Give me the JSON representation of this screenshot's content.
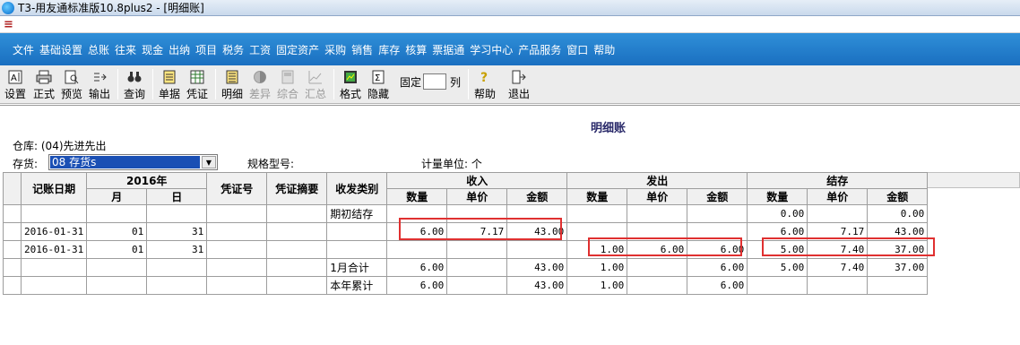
{
  "window": {
    "title": "T3-用友通标准版10.8plus2 - [明细账]"
  },
  "menu": [
    "文件",
    "基础设置",
    "总账",
    "往来",
    "现金",
    "出纳",
    "项目",
    "税务",
    "工资",
    "固定资产",
    "采购",
    "销售",
    "库存",
    "核算",
    "票据通",
    "学习中心",
    "产品服务",
    "窗口",
    "帮助"
  ],
  "toolbar": {
    "buttons": [
      {
        "label": "设置",
        "icon": "A|"
      },
      {
        "label": "正式",
        "icon": "print"
      },
      {
        "label": "预览",
        "icon": "preview"
      },
      {
        "label": "输出",
        "icon": "export"
      },
      {
        "label": "查询",
        "icon": "binoculars"
      },
      {
        "label": "单据",
        "icon": "doc"
      },
      {
        "label": "凭证",
        "icon": "voucher"
      },
      {
        "label": "明细",
        "icon": "detail"
      },
      {
        "label": "差异",
        "icon": "diff"
      },
      {
        "label": "综合",
        "icon": "combo"
      },
      {
        "label": "汇总",
        "icon": "sum"
      },
      {
        "label": "格式",
        "icon": "format"
      },
      {
        "label": "隐藏",
        "icon": "hide"
      },
      {
        "label": "帮助",
        "icon": "help"
      },
      {
        "label": "退出",
        "icon": "exit"
      }
    ],
    "fixed_label": "固定",
    "fixed_value": "",
    "col_label": "列"
  },
  "report": {
    "title": "明细账",
    "warehouse_label": "仓库:",
    "warehouse_value": "(04)先进先出",
    "stock_label": "存货:",
    "stock_value": "08 存货s",
    "spec_label": "规格型号:",
    "unit_label": "计量单位:",
    "unit_value": "个"
  },
  "table": {
    "headers": {
      "date": "记账日期",
      "year": "2016年",
      "month": "月",
      "day": "日",
      "voucher_no": "凭证号",
      "voucher_summary": "凭证摘要",
      "type": "收发类别",
      "in": "收入",
      "out": "发出",
      "balance": "结存",
      "qty": "数量",
      "price": "单价",
      "amount": "金额"
    },
    "rows": [
      {
        "date": "",
        "month": "",
        "day": "",
        "vno": "",
        "vsum": "",
        "type": "期初结存",
        "in_q": "",
        "in_p": "",
        "in_a": "",
        "out_q": "",
        "out_p": "",
        "out_a": "",
        "bal_q": "0.00",
        "bal_p": "",
        "bal_a": "0.00"
      },
      {
        "date": "2016-01-31",
        "month": "01",
        "day": "31",
        "vno": "",
        "vsum": "",
        "type": "",
        "in_q": "6.00",
        "in_p": "7.17",
        "in_a": "43.00",
        "out_q": "",
        "out_p": "",
        "out_a": "",
        "bal_q": "6.00",
        "bal_p": "7.17",
        "bal_a": "43.00"
      },
      {
        "date": "2016-01-31",
        "month": "01",
        "day": "31",
        "vno": "",
        "vsum": "",
        "type": "",
        "in_q": "",
        "in_p": "",
        "in_a": "",
        "out_q": "1.00",
        "out_p": "6.00",
        "out_a": "6.00",
        "bal_q": "5.00",
        "bal_p": "7.40",
        "bal_a": "37.00"
      },
      {
        "date": "",
        "month": "",
        "day": "",
        "vno": "",
        "vsum": "",
        "type": "1月合计",
        "in_q": "6.00",
        "in_p": "",
        "in_a": "43.00",
        "out_q": "1.00",
        "out_p": "",
        "out_a": "6.00",
        "bal_q": "5.00",
        "bal_p": "7.40",
        "bal_a": "37.00"
      },
      {
        "date": "",
        "month": "",
        "day": "",
        "vno": "",
        "vsum": "",
        "type": "本年累计",
        "in_q": "6.00",
        "in_p": "",
        "in_a": "43.00",
        "out_q": "1.00",
        "out_p": "",
        "out_a": "6.00",
        "bal_q": "",
        "bal_p": "",
        "bal_a": ""
      }
    ]
  },
  "colors": {
    "highlight": "#e03030",
    "menubar": "#1f7ccb",
    "selection": "#1a4fb4"
  }
}
